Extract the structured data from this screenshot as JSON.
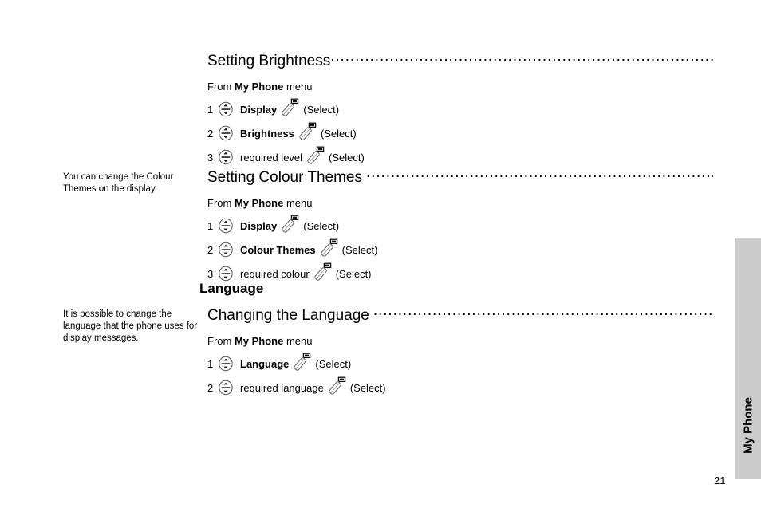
{
  "page": {
    "number": "21",
    "tab_label": "My Phone"
  },
  "margin_notes": {
    "colour_themes": "You can change the Colour Themes on the display.",
    "language": "It is possible to change the language that the phone uses for display messages."
  },
  "sections": [
    {
      "heading": "Setting Brightness",
      "intro_prefix": "From ",
      "intro_bold": "My Phone",
      "intro_suffix": " menu",
      "steps": [
        {
          "num": "1",
          "nav_icon": "navigation-key-icon",
          "label": "Display",
          "bold": true,
          "select_icon": "select-softkey-icon",
          "tail": "(Select)"
        },
        {
          "num": "2",
          "nav_icon": "navigation-key-icon",
          "label": "Brightness",
          "bold": true,
          "select_icon": "select-softkey-icon",
          "tail": "(Select)"
        },
        {
          "num": "3",
          "nav_icon": "navigation-key-icon",
          "label": "required level",
          "bold": false,
          "select_icon": "select-softkey-icon",
          "tail": "(Select)"
        }
      ]
    },
    {
      "heading": "Setting Colour Themes",
      "intro_prefix": "From ",
      "intro_bold": "My Phone",
      "intro_suffix": " menu",
      "steps": [
        {
          "num": "1",
          "nav_icon": "navigation-key-icon",
          "label": "Display",
          "bold": true,
          "select_icon": "select-softkey-icon",
          "tail": "(Select)"
        },
        {
          "num": "2",
          "nav_icon": "navigation-key-icon",
          "label": "Colour Themes",
          "bold": true,
          "select_icon": "select-softkey-icon",
          "tail": "(Select)"
        },
        {
          "num": "3",
          "nav_icon": "navigation-key-icon",
          "label": "required colour",
          "bold": false,
          "select_icon": "select-softkey-icon",
          "tail": "(Select)"
        }
      ]
    },
    {
      "chapter": "Language",
      "heading": "Changing the Language",
      "intro_prefix": "From ",
      "intro_bold": "My Phone",
      "intro_suffix": " menu",
      "steps": [
        {
          "num": "1",
          "nav_icon": "navigation-key-icon",
          "label": "Language",
          "bold": true,
          "select_icon": "select-softkey-icon",
          "tail": "(Select)"
        },
        {
          "num": "2",
          "nav_icon": "navigation-key-icon",
          "label": "required language",
          "bold": false,
          "select_icon": "select-softkey-icon",
          "tail": "(Select)"
        }
      ]
    }
  ],
  "colors": {
    "tab_gray": "#cccccc",
    "text": "#000000",
    "background": "#ffffff"
  }
}
